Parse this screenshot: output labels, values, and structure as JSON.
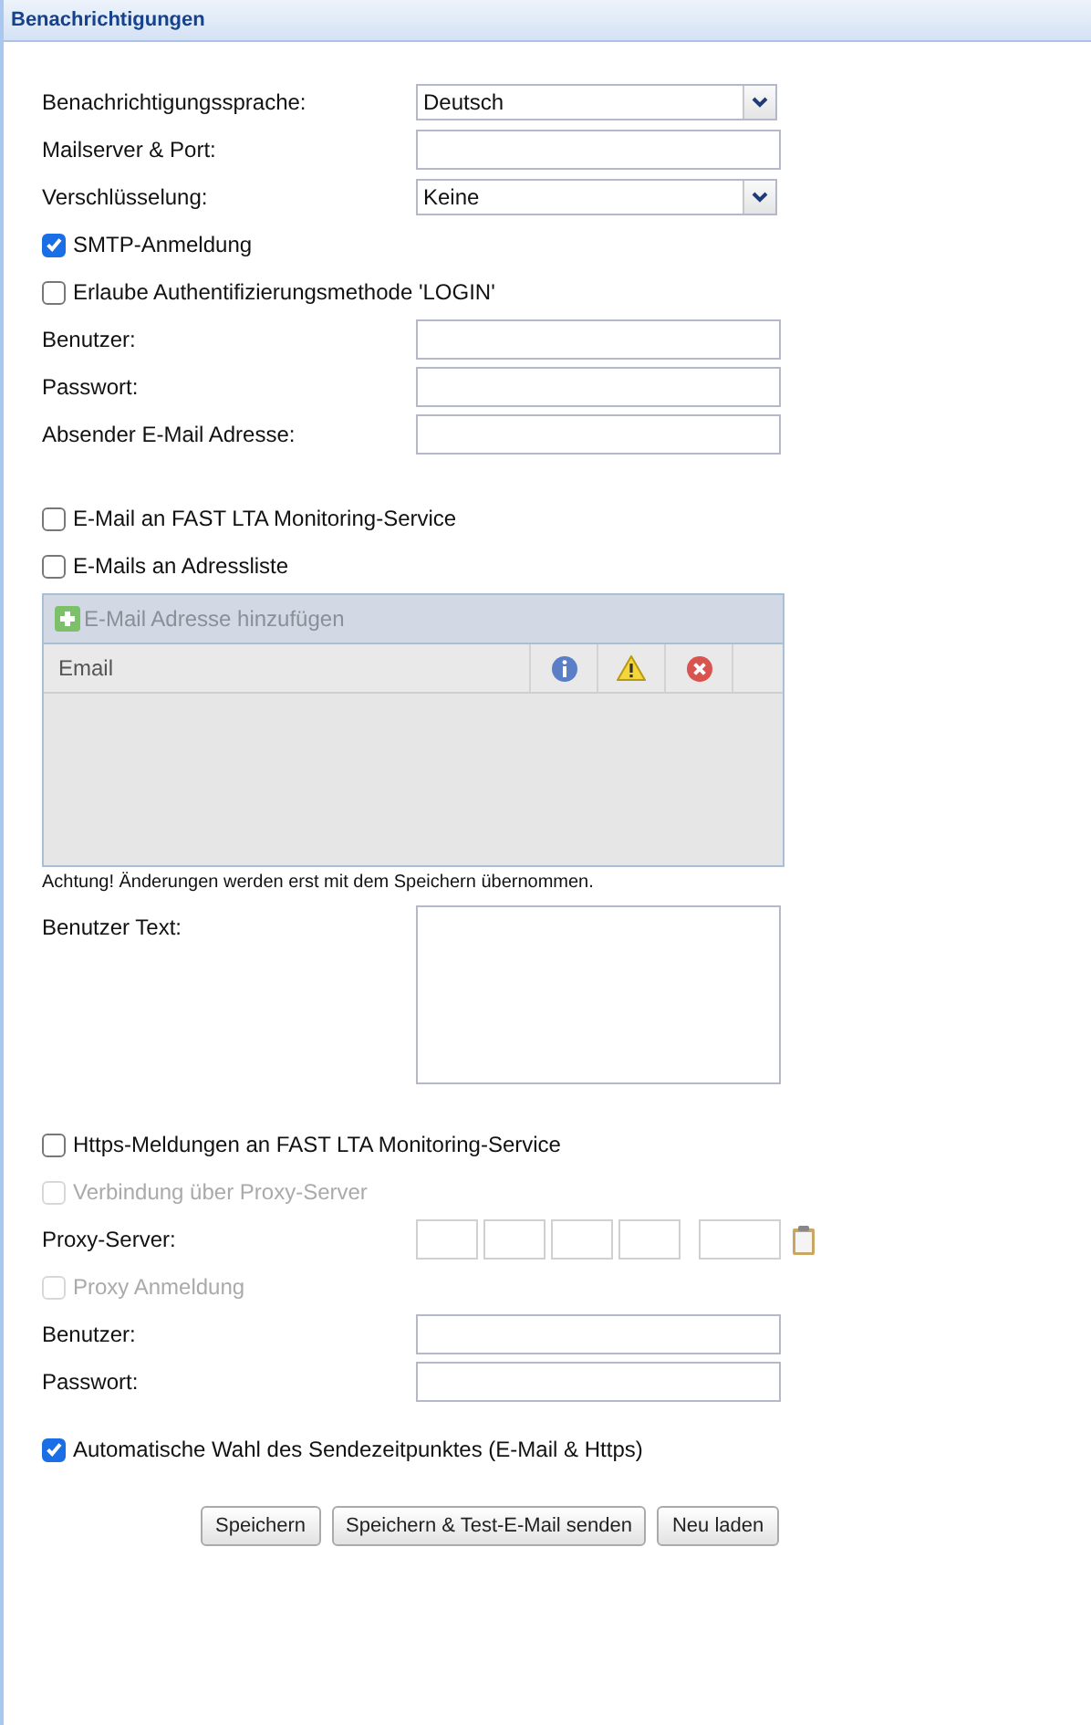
{
  "panel": {
    "title": "Benachrichtigungen"
  },
  "sections": [
    {
      "rows": [
        {
          "kind": "select",
          "label": "Benachrichtigungssprache:",
          "value": "Deutsch"
        },
        {
          "kind": "input",
          "label": "Mailserver & Port:"
        },
        {
          "kind": "select",
          "label": "Verschlüsselung:",
          "value": "Keine"
        },
        {
          "kind": "checkbox",
          "label": "SMTP-Anmeldung",
          "checked": true,
          "disabled": false
        },
        {
          "kind": "checkbox",
          "label": "Erlaube Authentifizierungsmethode 'LOGIN'",
          "checked": false,
          "disabled": false
        },
        {
          "kind": "input",
          "label": "Benutzer:"
        },
        {
          "kind": "input",
          "label": "Passwort:"
        },
        {
          "kind": "input",
          "label": "Absender E-Mail Adresse:"
        }
      ]
    },
    {
      "rows": [
        {
          "kind": "checkbox",
          "label": "E-Mail an FAST LTA Monitoring-Service",
          "checked": false,
          "disabled": false
        },
        {
          "kind": "checkbox",
          "label": "E-Mails an Adressliste",
          "checked": false,
          "disabled": false
        },
        {
          "kind": "grid",
          "add_button": "E-Mail Adresse hinzufügen",
          "column": "Email"
        },
        {
          "kind": "note",
          "label": "Achtung! Änderungen werden erst mit dem Speichern übernommen."
        },
        {
          "kind": "textarea",
          "label": "Benutzer Text:"
        }
      ]
    },
    {
      "rows": [
        {
          "kind": "checkbox",
          "label": "Https-Meldungen an FAST LTA Monitoring-Service",
          "checked": false,
          "disabled": false
        },
        {
          "kind": "checkbox",
          "label": "Verbindung über Proxy-Server",
          "checked": false,
          "disabled": true
        },
        {
          "kind": "ip",
          "label": "Proxy-Server:"
        },
        {
          "kind": "checkbox",
          "label": "Proxy Anmeldung",
          "checked": false,
          "disabled": true
        },
        {
          "kind": "input",
          "label": "Benutzer:"
        },
        {
          "kind": "input",
          "label": "Passwort:"
        }
      ]
    },
    {
      "rows": [
        {
          "kind": "checkbox",
          "label": "Automatische Wahl des Sendezeitpunktes (E-Mail & Https)",
          "checked": true,
          "disabled": false
        }
      ]
    }
  ],
  "buttons": [
    "Speichern",
    "Speichern & Test-E-Mail senden",
    "Neu laden"
  ]
}
